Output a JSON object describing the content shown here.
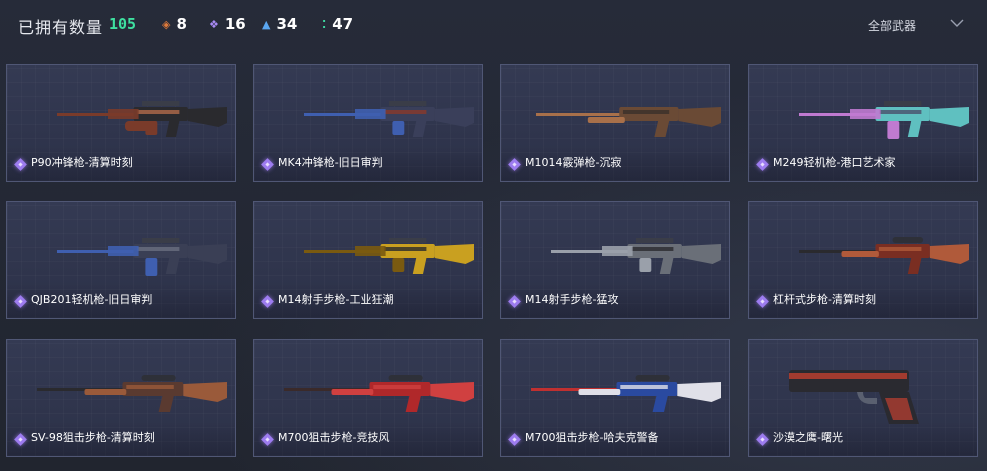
{
  "header": {
    "owned_label": "已拥有数量",
    "owned_count": "105",
    "stats": [
      {
        "icon": "orange-rarity-icon",
        "color": "#e07a3a",
        "symbol": "◈",
        "value": "8"
      },
      {
        "icon": "purple-rarity-icon",
        "color": "#a98bf5",
        "symbol": "❖",
        "value": "16"
      },
      {
        "icon": "blue-rarity-icon",
        "color": "#5aa6f0",
        "symbol": "▲",
        "value": "34"
      },
      {
        "icon": "green-rarity-icon",
        "color": "#3ed6a0",
        "symbol": "⁚",
        "value": "47"
      }
    ],
    "filter_label": "全部武器"
  },
  "weapons": [
    {
      "name": "P90冲锋枪-清算时刻",
      "kind": "smg",
      "colors": [
        "#2a2a2e",
        "#7a3b2a",
        "#b06a4a"
      ]
    },
    {
      "name": "MK4冲锋枪-旧日审判",
      "kind": "rifle",
      "colors": [
        "#3a3f5a",
        "#3f5fb0",
        "#8a3a2a"
      ]
    },
    {
      "name": "M1014霰弹枪-沉寂",
      "kind": "shotgun",
      "colors": [
        "#6a4a35",
        "#a8704a",
        "#3a302a"
      ]
    },
    {
      "name": "M249轻机枪-港口艺术家",
      "kind": "lmg",
      "colors": [
        "#5fc0c0",
        "#c07ad0",
        "#4a4f6a"
      ]
    },
    {
      "name": "QJB201轻机枪-旧日审判",
      "kind": "lmg",
      "colors": [
        "#3a3f55",
        "#3f5fb0",
        "#6a6f80"
      ]
    },
    {
      "name": "M14射手步枪-工业狂潮",
      "kind": "rifle",
      "colors": [
        "#c9a020",
        "#7a5a10",
        "#2a2a2a"
      ]
    },
    {
      "name": "M14射手步枪-猛攻",
      "kind": "rifle",
      "colors": [
        "#6a6f78",
        "#9aa0aa",
        "#2a2a2e"
      ]
    },
    {
      "name": "杠杆式步枪-清算时刻",
      "kind": "lever",
      "colors": [
        "#7a2e22",
        "#2a2a2e",
        "#b05a3a"
      ]
    },
    {
      "name": "SV-98狙击步枪-清算时刻",
      "kind": "sniper",
      "colors": [
        "#5a3a30",
        "#2a2a2e",
        "#9a5a3a"
      ]
    },
    {
      "name": "M700狙击步枪-竞技风",
      "kind": "sniper",
      "colors": [
        "#b0282a",
        "#3a2a2a",
        "#d04040"
      ]
    },
    {
      "name": "M700狙击步枪-哈夫克警备",
      "kind": "sniper",
      "colors": [
        "#2a4aa0",
        "#c03030",
        "#e0e0e8"
      ]
    },
    {
      "name": "沙漠之鹰-曙光",
      "kind": "pistol",
      "colors": [
        "#2a2a30",
        "#c04030",
        "#5a6070"
      ]
    }
  ]
}
